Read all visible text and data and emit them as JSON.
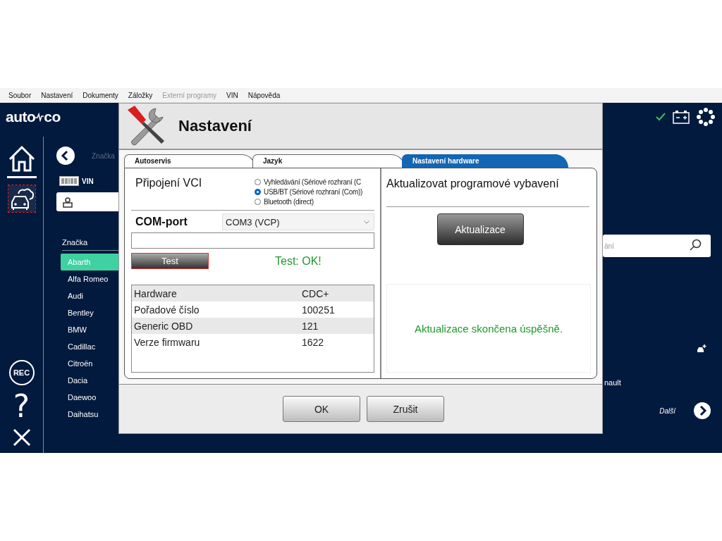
{
  "menu": [
    {
      "label": "Soubor",
      "disabled": false
    },
    {
      "label": "Nastavení",
      "disabled": false
    },
    {
      "label": "Dokumenty",
      "disabled": false
    },
    {
      "label": "Záložky",
      "disabled": false
    },
    {
      "label": "Externí programy",
      "disabled": true
    },
    {
      "label": "VIN",
      "disabled": false
    },
    {
      "label": "Nápověda",
      "disabled": false
    }
  ],
  "logo": [
    "auto",
    "co"
  ],
  "rail": [
    {
      "kind": "home",
      "selected": false
    },
    {
      "kind": "vehicles",
      "selected": true
    }
  ],
  "rail_bottom": {
    "rec": "REC",
    "help": "?"
  },
  "breadcrumb": "Značka",
  "vin_label": "VIN",
  "brands": {
    "heading": "Značka",
    "items": [
      {
        "label": "Abarth",
        "selected": true
      },
      {
        "label": "Alfa Romeo",
        "selected": false
      },
      {
        "label": "Audi",
        "selected": false
      },
      {
        "label": "Bentley",
        "selected": false
      },
      {
        "label": "BMW",
        "selected": false
      },
      {
        "label": "Cadillac",
        "selected": false
      },
      {
        "label": "Citroën",
        "selected": false
      },
      {
        "label": "Dacia",
        "selected": false
      },
      {
        "label": "Daewoo",
        "selected": false
      },
      {
        "label": "Daihatsu",
        "selected": false
      }
    ]
  },
  "search": {
    "placeholder": "ání"
  },
  "brand_cut": "nault",
  "next_label": "Další",
  "dialog": {
    "title": "Nastavení",
    "tabs": [
      {
        "label": "Autoservis",
        "selected": false
      },
      {
        "label": "Jazyk",
        "selected": false
      },
      {
        "label": "Nastavení hardware",
        "selected": true
      }
    ],
    "connection": {
      "title": "Připojení VCI",
      "options": [
        {
          "label": "Vyhledávání (Sériové rozhraní (C",
          "selected": false
        },
        {
          "label": "USB/BT (Sériové rozhraní (Com))",
          "selected": true
        },
        {
          "label": "Bluetooth (direct)",
          "selected": false
        }
      ]
    },
    "com_port": {
      "label": "COM-port",
      "value": "COM3 (VCP)"
    },
    "test_button": "Test",
    "test_result": "Test: OK!",
    "info": [
      {
        "label": "Hardware",
        "value": "CDC+"
      },
      {
        "label": "Pořadové číslo",
        "value": "100251"
      },
      {
        "label": "Generic OBD",
        "value": "121"
      },
      {
        "label": "Verze firmwaru",
        "value": "1622"
      }
    ],
    "update": {
      "title": "Aktualizovat programové vybavení",
      "button": "Aktualizace",
      "message": "Aktualizace skončena úspěšně."
    },
    "buttons": [
      "OK",
      "Zrušit"
    ]
  }
}
